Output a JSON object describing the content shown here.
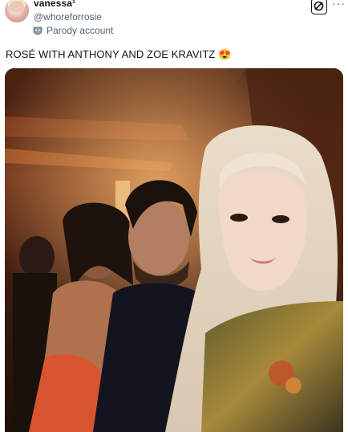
{
  "post": {
    "display_name": "vanessa¹",
    "handle": "@whoreforrosie",
    "parody_label": "Parody account",
    "text": "ROSÉ WITH ANTHONY AND ZOE KRAVITZ 😍",
    "grok_icon": "slash-circle-icon",
    "more_icon": "more-icon",
    "more_glyph": "···"
  },
  "photo": {
    "subject": "selfie at a dimly lit restaurant",
    "colors": {
      "background": "#2a140c",
      "ceiling": "#7a3a1e",
      "light": "#f0a868"
    }
  }
}
